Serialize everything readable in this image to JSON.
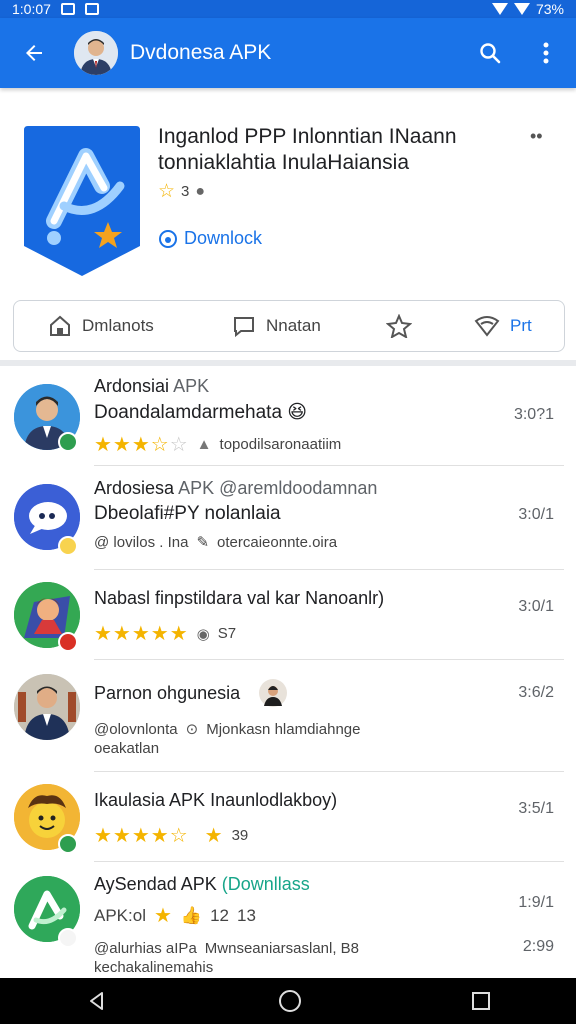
{
  "status_bar": {
    "time": "1:0:07",
    "battery": "73%"
  },
  "app_bar": {
    "title": "Dvdonesa APK"
  },
  "header": {
    "title": "Inganlod PPP Inlonntian INaann tonniaklahtia InulaHaiansia",
    "rating": "3",
    "download_label": "Downlock"
  },
  "tabs": [
    {
      "label": "Dmlanots",
      "icon": "home-icon"
    },
    {
      "label": "Nnatan",
      "icon": "chat-icon"
    },
    {
      "label": "",
      "icon": "star-icon"
    },
    {
      "label": "Prt",
      "icon": "wifi-icon"
    }
  ],
  "list": [
    {
      "name": "Ardonsiai",
      "name_sub": "APK",
      "message": "Doandalamdarmehata",
      "emoji": "😆",
      "meta": "topodilsaronaatiim",
      "time": "3:0?1",
      "stars": 3.5
    },
    {
      "name": "Ardosiesa",
      "name_sub": "APK @aremldoodamnan",
      "message": "Dbeolafi#PY nolanlaia",
      "meta": "@ lovilos . Ina",
      "meta2": "otercaieonnte.oira",
      "time": "3:0/1"
    },
    {
      "name": "Nabasl finpstildara val kar Nanoanlr)",
      "message": "",
      "meta": "S7",
      "time": "3:0/1",
      "stars": 5
    },
    {
      "name": "Parnon ohgunesia",
      "message": "",
      "meta": "@olovnlonta",
      "meta2": "Mjonkasn hlamdiahnge",
      "meta3": "oeakatlan",
      "time": "3:6/2"
    },
    {
      "name": "Ikaulasia APK Inaunlodlakboy)",
      "message": "",
      "meta": "39",
      "time": "3:5/1",
      "stars": 4.5
    },
    {
      "name": "AySendad APK",
      "name_green": "(Downllass",
      "message": "APK:ol",
      "meta": "12",
      "meta2": "13",
      "line3": "@alurhias aIPa",
      "line3b": "Mwnseaniarsaslanl, B8",
      "line4": "kechakalinemahis",
      "time": "1:9/1",
      "time2": "2:99"
    }
  ],
  "colors": {
    "primary": "#1a73e8",
    "star": "#f4b400",
    "green": "#17a589"
  }
}
